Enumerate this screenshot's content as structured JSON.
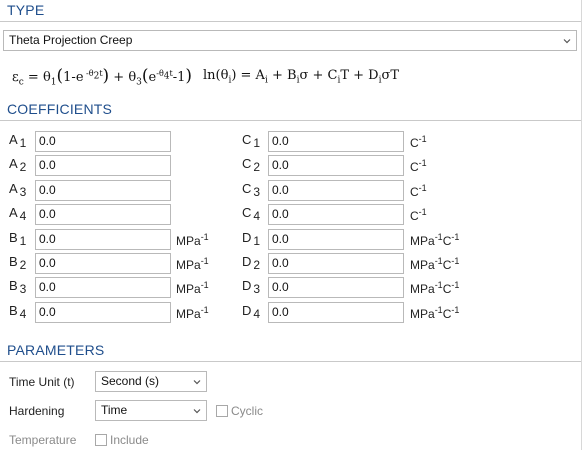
{
  "type_section": {
    "title": "TYPE",
    "model_selected": "Theta Projection Creep"
  },
  "formulas": {
    "strain": "εc = θ1(1-e^(-θ2t)) + θ3(e^(-θ4t)-1)",
    "theta": "ln(θi) = Ai + Biσ + CiT + DiσT"
  },
  "coefficients": {
    "title": "COEFFICIENTS",
    "left": [
      {
        "letter": "A",
        "sub": "1",
        "value": "0.0",
        "unit": ""
      },
      {
        "letter": "A",
        "sub": "2",
        "value": "0.0",
        "unit": ""
      },
      {
        "letter": "A",
        "sub": "3",
        "value": "0.0",
        "unit": ""
      },
      {
        "letter": "A",
        "sub": "4",
        "value": "0.0",
        "unit": ""
      },
      {
        "letter": "B",
        "sub": "1",
        "value": "0.0",
        "unit": "MPa",
        "unit_exp": "-1"
      },
      {
        "letter": "B",
        "sub": "2",
        "value": "0.0",
        "unit": "MPa",
        "unit_exp": "-1"
      },
      {
        "letter": "B",
        "sub": "3",
        "value": "0.0",
        "unit": "MPa",
        "unit_exp": "-1"
      },
      {
        "letter": "B",
        "sub": "4",
        "value": "0.0",
        "unit": "MPa",
        "unit_exp": "-1"
      }
    ],
    "right": [
      {
        "letter": "C",
        "sub": "1",
        "value": "0.0",
        "unit": "C",
        "unit_exp": "-1"
      },
      {
        "letter": "C",
        "sub": "2",
        "value": "0.0",
        "unit": "C",
        "unit_exp": "-1"
      },
      {
        "letter": "C",
        "sub": "3",
        "value": "0.0",
        "unit": "C",
        "unit_exp": "-1"
      },
      {
        "letter": "C",
        "sub": "4",
        "value": "0.0",
        "unit": "C",
        "unit_exp": "-1"
      },
      {
        "letter": "D",
        "sub": "1",
        "value": "0.0",
        "unit": "MPa",
        "unit_exp": "-1",
        "unit2": "C",
        "unit2_exp": "-1"
      },
      {
        "letter": "D",
        "sub": "2",
        "value": "0.0",
        "unit": "MPa",
        "unit_exp": "-1",
        "unit2": "C",
        "unit2_exp": "-1"
      },
      {
        "letter": "D",
        "sub": "3",
        "value": "0.0",
        "unit": "MPa",
        "unit_exp": "-1",
        "unit2": "C",
        "unit2_exp": "-1"
      },
      {
        "letter": "D",
        "sub": "4",
        "value": "0.0",
        "unit": "MPa",
        "unit_exp": "-1",
        "unit2": "C",
        "unit2_exp": "-1"
      }
    ]
  },
  "parameters": {
    "title": "PARAMETERS",
    "time_unit_label": "Time Unit (t)",
    "time_unit_value": "Second (s)",
    "hardening_label": "Hardening",
    "hardening_value": "Time",
    "cyclic_label": "Cyclic",
    "cyclic_checked": false,
    "temperature_label": "Temperature",
    "include_label": "Include",
    "include_checked": false
  },
  "colors": {
    "section_title": "#1f4e8c",
    "border": "#b9b9b9",
    "disabled_text": "#8a8a8a"
  }
}
